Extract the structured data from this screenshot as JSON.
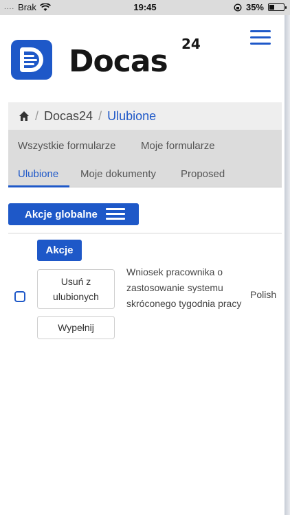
{
  "status_bar": {
    "signal_dots": "....",
    "carrier": "Brak",
    "time": "19:45",
    "battery": "35%",
    "battery_level": 0.35
  },
  "brand": {
    "name": "Docas",
    "superscript": "24",
    "accent_color": "#1e58c8"
  },
  "breadcrumb": {
    "home_icon": "home-icon",
    "separator": "/",
    "items": [
      "Docas24",
      "Ulubione"
    ]
  },
  "tabs": [
    {
      "label": "Wszystkie formularze",
      "active": false
    },
    {
      "label": "Moje formularze",
      "active": false
    },
    {
      "label": "Ulubione",
      "active": true
    },
    {
      "label": "Moje dokumenty",
      "active": false
    },
    {
      "label": "Proposed",
      "active": false
    }
  ],
  "global_actions": {
    "label": "Akcje globalne",
    "icon": "menu-icon"
  },
  "row": {
    "actions_label": "Akcje",
    "remove_favorite_label": "Usuń z ulubionych",
    "fill_label": "Wypełnij",
    "title": "Wniosek pracownika o zastosowanie systemu skróconego tygodnia pracy",
    "language": "Polish",
    "checked": false
  }
}
